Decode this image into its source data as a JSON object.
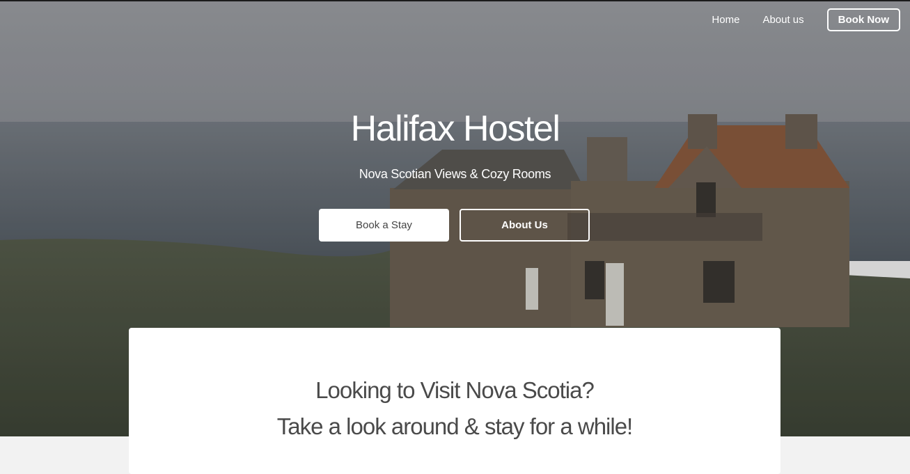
{
  "nav": {
    "home": "Home",
    "about": "About us",
    "book_now": "Book Now"
  },
  "hero": {
    "title": "Halifax Hostel",
    "subtitle": "Nova Scotian Views & Cozy Rooms",
    "btn_book": "Book a Stay",
    "btn_about": "About Us"
  },
  "intro": {
    "line1": "Looking to Visit Nova Scotia?",
    "line2": "Take a look around & stay for a while!"
  },
  "colors": {
    "sky": "#9a9ca1",
    "sea": "#5f676f",
    "grass": "#4c5343",
    "stone": "#6f6355",
    "roof": "#8a5a3e",
    "page_bg": "#f2f2f2",
    "text_dark": "#4a4a4a"
  }
}
